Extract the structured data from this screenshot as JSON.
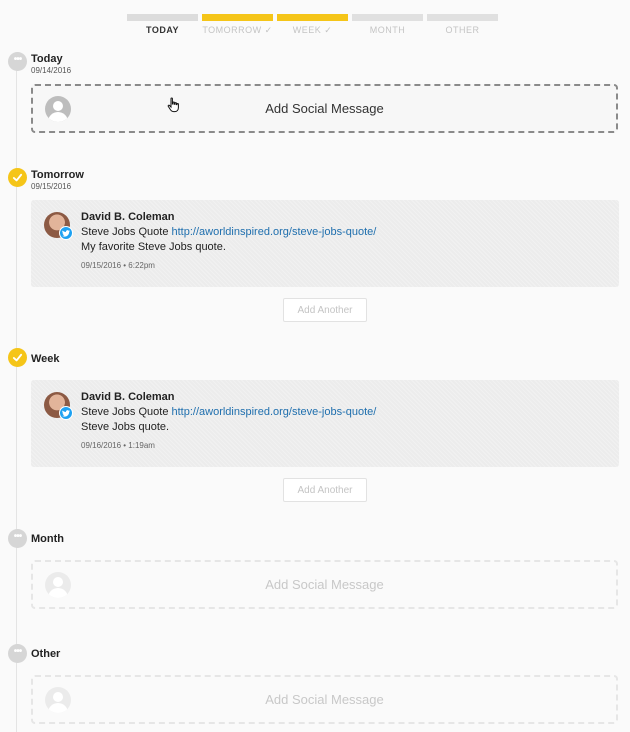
{
  "tabs": [
    {
      "label": "TODAY",
      "state": "current"
    },
    {
      "label": "TOMORROW ✓",
      "state": "done"
    },
    {
      "label": "WEEK ✓",
      "state": "done"
    },
    {
      "label": "MONTH",
      "state": "pending"
    },
    {
      "label": "OTHER",
      "state": "pending"
    }
  ],
  "colors": {
    "accent": "#f5c518",
    "link": "#1f6fae",
    "twitter": "#1da1f2"
  },
  "sections": {
    "today": {
      "title": "Today",
      "date": "09/14/2016",
      "add_label": "Add Social Message"
    },
    "tomorrow": {
      "title": "Tomorrow",
      "date": "09/15/2016",
      "post": {
        "author": "David B. Coleman",
        "text_prefix": "Steve Jobs Quote ",
        "link": "http://aworldinspired.org/steve-jobs-quote/",
        "caption": "My favorite Steve Jobs quote.",
        "meta": "09/15/2016 • 6:22pm",
        "network_icon": "twitter-icon"
      },
      "add_another": "Add Another"
    },
    "week": {
      "title": "Week",
      "post": {
        "author": "David B. Coleman",
        "text_prefix": "Steve Jobs Quote ",
        "link": "http://aworldinspired.org/steve-jobs-quote/",
        "caption": "Steve Jobs quote.",
        "meta": "09/16/2016 • 1:19am",
        "network_icon": "twitter-icon"
      },
      "add_another": "Add Another"
    },
    "month": {
      "title": "Month",
      "add_label": "Add Social Message"
    },
    "other": {
      "title": "Other",
      "add_label": "Add Social Message"
    }
  }
}
